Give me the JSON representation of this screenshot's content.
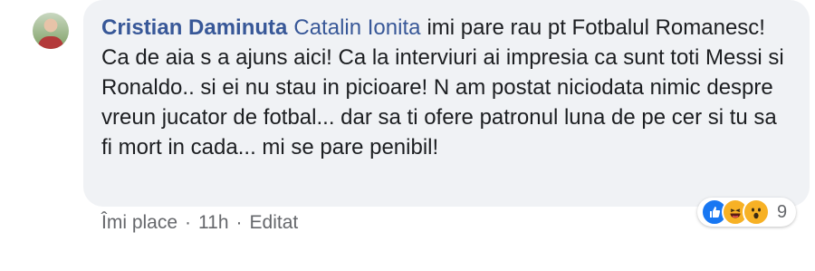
{
  "comment": {
    "author": "Cristian Daminuta",
    "mention": "Catalin Ionita",
    "body": "imi pare rau pt Fotbalul Romanesc! Ca de aia s a ajuns aici! Ca la interviuri ai impresia ca sunt toti Messi si Ronaldo.. si ei nu stau in picioare! N am postat niciodata nimic despre vreun jucator de fotbal... dar sa ti ofere patronul luna de pe cer si tu sa fi mort in cada... mi se pare penibil!"
  },
  "reactions": {
    "icons": [
      "like-icon",
      "haha-icon",
      "wow-icon"
    ],
    "count": "9"
  },
  "actions": {
    "like_label": "Îmi place",
    "separator": "·",
    "time": "11h",
    "edited": "Editat"
  },
  "colors": {
    "bubble": "#f0f2f5",
    "name": "#385898",
    "text": "#1c1e21",
    "meta": "#65676b",
    "like": "#1877f2",
    "emoji": "#f7b125"
  }
}
